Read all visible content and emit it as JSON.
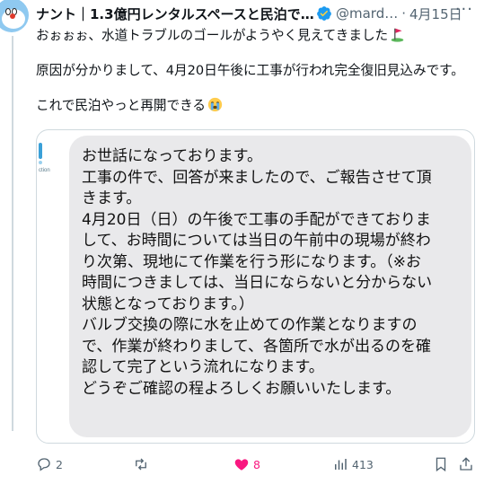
{
  "tweet": {
    "author_name": "ナント｜1.3億円レンタルスペースと民泊で稼…",
    "handle": "@mard…",
    "separator": "·",
    "date": "4月15日",
    "more_icon": "more-icon",
    "lines": [
      "おぉぉぉ、水道トラブルのゴールがようやく見えてきました",
      "原因が分かりまして、4月20日午後に工事が行われ完全復旧見込みです。",
      "これで民泊やっと再開できる"
    ],
    "emojis": [
      "golf-flag-icon",
      "crying-face-icon"
    ]
  },
  "image": {
    "logo_text": "ction",
    "message_lines": [
      "お世話になっております。",
      "工事の件で、回答が来ましたので、ご報告させて頂",
      "きます。",
      "4月20日（日）の午後で工事の手配ができておりま",
      "して、お時間については当日の午前中の現場が終わ",
      "り次第、現地にて作業を行う形になります。（※お",
      "時間につきましては、当日にならないと分からない",
      "状態となっております。）",
      "バルブ交換の際に水を止めての作業となりますの",
      "で、作業が終わりまして、各箇所で水が出るのを確",
      "認して完了という流れになります。",
      "どうぞご確認の程よろしくお願いいたします。"
    ]
  },
  "actions": {
    "reply_count": "2",
    "retweet_count": "",
    "like_count": "8",
    "view_count": "413",
    "colors": {
      "like": "#f91880",
      "muted": "#536471"
    }
  }
}
